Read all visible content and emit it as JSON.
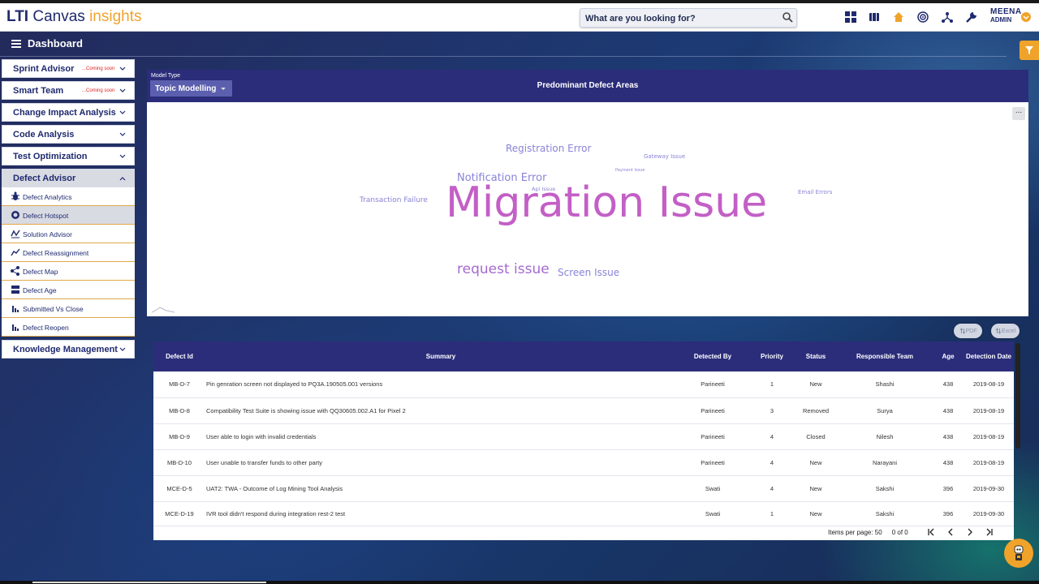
{
  "app": {
    "brand_lti": "LTI",
    "brand_canvas": "Canvas",
    "brand_insights": "insights"
  },
  "search": {
    "placeholder": "What are you looking for?"
  },
  "toolbar_icons": [
    "dashboard-grid-icon",
    "wallet-icon",
    "home-icon",
    "target-icon",
    "network-icon",
    "wrench-icon"
  ],
  "user": {
    "name": "MEENA",
    "role": "ADMIN"
  },
  "page": {
    "title": "Dashboard"
  },
  "sidebar": {
    "items": [
      {
        "label": "Sprint Advisor",
        "badge": "...Coming soon"
      },
      {
        "label": "Smart Team",
        "badge": "...Coming soon"
      },
      {
        "label": "Change Impact Analysis",
        "badge": ""
      },
      {
        "label": "Code Analysis",
        "badge": ""
      },
      {
        "label": "Test Optimization",
        "badge": ""
      },
      {
        "label": "Defect Advisor",
        "badge": ""
      }
    ],
    "sub_items": [
      {
        "label": "Defect Analytics",
        "icon": "bug-icon"
      },
      {
        "label": "Defect Hotspot",
        "icon": "hotspot-icon"
      },
      {
        "label": "Solution Advisor",
        "icon": "solution-icon"
      },
      {
        "label": "Defect Reassignment",
        "icon": "trend-icon"
      },
      {
        "label": "Defect Map",
        "icon": "share-icon"
      },
      {
        "label": "Defect Age",
        "icon": "age-icon"
      },
      {
        "label": "Submitted Vs Close",
        "icon": "bar-chart-icon"
      },
      {
        "label": "Defect Reopen",
        "icon": "bar-chart-icon"
      }
    ],
    "last_item": {
      "label": "Knowledge Management"
    }
  },
  "wordcloud": {
    "model_type_label": "Model Type",
    "model_type_value": "Topic Modelling",
    "title": "Predominant Defect Areas",
    "more": "...",
    "words": [
      {
        "text": "Migration Issue",
        "color": "#c35fc6"
      },
      {
        "text": "Registration Error",
        "color": "#8a83d8"
      },
      {
        "text": "Notification Error",
        "color": "#8a83d8"
      },
      {
        "text": "Gateway Issue",
        "color": "#8a83d8"
      },
      {
        "text": "Payment Issue",
        "color": "#8a83d8"
      },
      {
        "text": "Api Issue",
        "color": "#8a83d8"
      },
      {
        "text": "Transaction Failure",
        "color": "#8a83d8"
      },
      {
        "text": "Email Errors",
        "color": "#8a83d8"
      },
      {
        "text": "request issue",
        "color": "#a46ad1"
      },
      {
        "text": "Screen Issue",
        "color": "#8a83d8"
      }
    ]
  },
  "export": {
    "pdf": "PDF",
    "excel": "Excel"
  },
  "table": {
    "columns": [
      "Defect Id",
      "Summary",
      "Detected By",
      "Priority",
      "Status",
      "Responsible Team",
      "Age",
      "Detection Date"
    ],
    "rows": [
      [
        "MB-D-7",
        "Pin genration screen not displayed to PQ3A.190505.001 versions",
        "Parineeti",
        "1",
        "New",
        "Shashi",
        "438",
        "2019-08-19"
      ],
      [
        "MB-D-8",
        "Compatibility Test Suite is showing issue with QQ30605.002.A1 for Pixel 2",
        "Parineeti",
        "3",
        "Removed",
        "Surya",
        "438",
        "2019-08-19"
      ],
      [
        "MB-D-9",
        "User able to login with invalid credentials",
        "Parineeti",
        "4",
        "Closed",
        "Nilesh",
        "438",
        "2019-08-19"
      ],
      [
        "MB-D-10",
        "User unable to transfer funds to other party",
        "Parineeti",
        "4",
        "New",
        "Narayani",
        "438",
        "2019-08-19"
      ],
      [
        "MCE-D-5",
        "UAT2: TWA - Outcome of Log Mining Tool Analysis",
        "Swati",
        "4",
        "New",
        "Sakshi",
        "396",
        "2019-09-30"
      ],
      [
        "MCE-D-19",
        "IVR tool didn't respond during integration rest-2 test",
        "Swati",
        "1",
        "New",
        "Sakshi",
        "396",
        "2019-09-30"
      ]
    ]
  },
  "pager": {
    "items_per_page_label": "Items per page: 50",
    "range": "0 of 0"
  }
}
